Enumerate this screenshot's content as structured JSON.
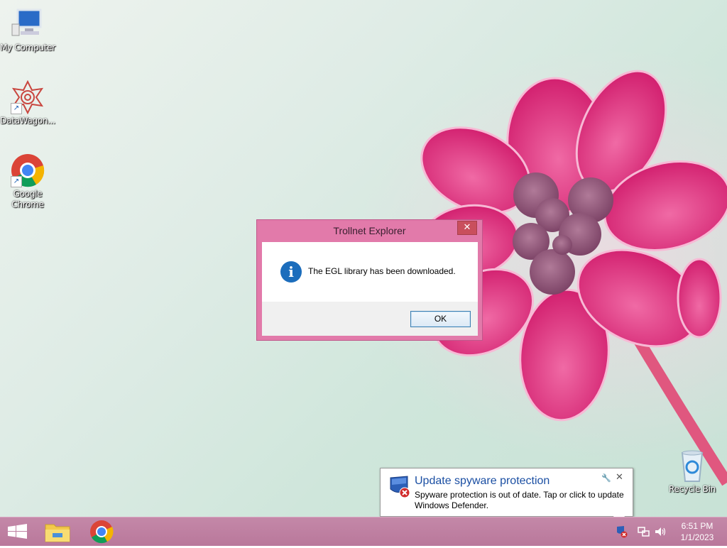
{
  "desktop_icons": [
    {
      "label": "My Computer",
      "icon": "computer-icon"
    },
    {
      "label": "DataWagon...",
      "icon": "datawagon-icon"
    },
    {
      "label": "Google Chrome",
      "icon": "chrome-icon"
    },
    {
      "label": "Recycle Bin",
      "icon": "recycle-bin-icon"
    }
  ],
  "dialog": {
    "title": "Trollnet Explorer",
    "close_glyph": "✕",
    "message": "The EGL library has been downloaded.",
    "ok_label": "OK",
    "icon": "info-icon",
    "accent": "#e27aaa"
  },
  "notification": {
    "title": "Update spyware protection",
    "text": "Spyware protection is out of date. Tap or click to update Windows Defender.",
    "options_glyph": "🔧",
    "close_glyph": "✕",
    "icon": "defender-shield-icon"
  },
  "taskbar": {
    "pinned": [
      "start-button",
      "file-explorer-icon",
      "chrome-icon"
    ],
    "tray": [
      "defender-warning-icon",
      "network-icon",
      "volume-icon"
    ],
    "time": "6:51 PM",
    "date": "1/1/2023",
    "color": "#bf82a3"
  }
}
